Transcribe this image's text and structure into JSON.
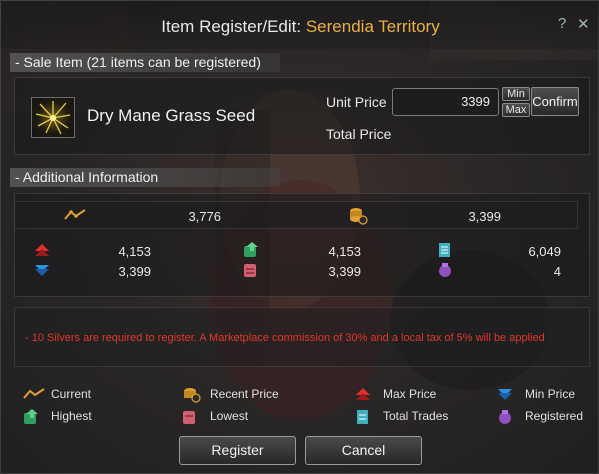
{
  "window": {
    "title_prefix": "Item Register/Edit: ",
    "title_zone": "Serendia Territory",
    "help_glyph": "?",
    "close_glyph": "✕"
  },
  "sale_item": {
    "header": "- Sale Item (21 items can be registered)",
    "item_name": "Dry Mane Grass Seed",
    "unit_price_label": "Unit Price",
    "unit_price_value": "3399",
    "min_label": "Min",
    "max_label": "Max",
    "confirm_label": "Confirm",
    "total_price_label": "Total Price"
  },
  "additional": {
    "header": "- Additional Information",
    "current": "3,776",
    "recent_price": "3,399",
    "max_price": "4,153",
    "min_price": "3,399",
    "highest": "4,153",
    "lowest": "3,399",
    "total_trades": "6,049",
    "registered": "4",
    "notice": "- 10 Silvers are required to register. A Marketplace commission of 30% and a local tax of 5% will be applied"
  },
  "legend": {
    "current": "Current",
    "recent_price": "Recent Price",
    "max_price": "Max Price",
    "min_price": "Min Price",
    "highest": "Highest",
    "lowest": "Lowest",
    "total_trades": "Total Trades",
    "registered": "Registered"
  },
  "buttons": {
    "register": "Register",
    "cancel": "Cancel"
  },
  "colors": {
    "title_zone": "#e8b240",
    "notice_text": "#e0382c",
    "current_icon": "#e0a030",
    "max_price_icon": "#e03030",
    "min_price_icon": "#3090e0",
    "highest_icon": "#30a060",
    "lowest_icon": "#d06070",
    "total_trades_icon": "#40b0c0",
    "registered_icon": "#9050c0"
  }
}
